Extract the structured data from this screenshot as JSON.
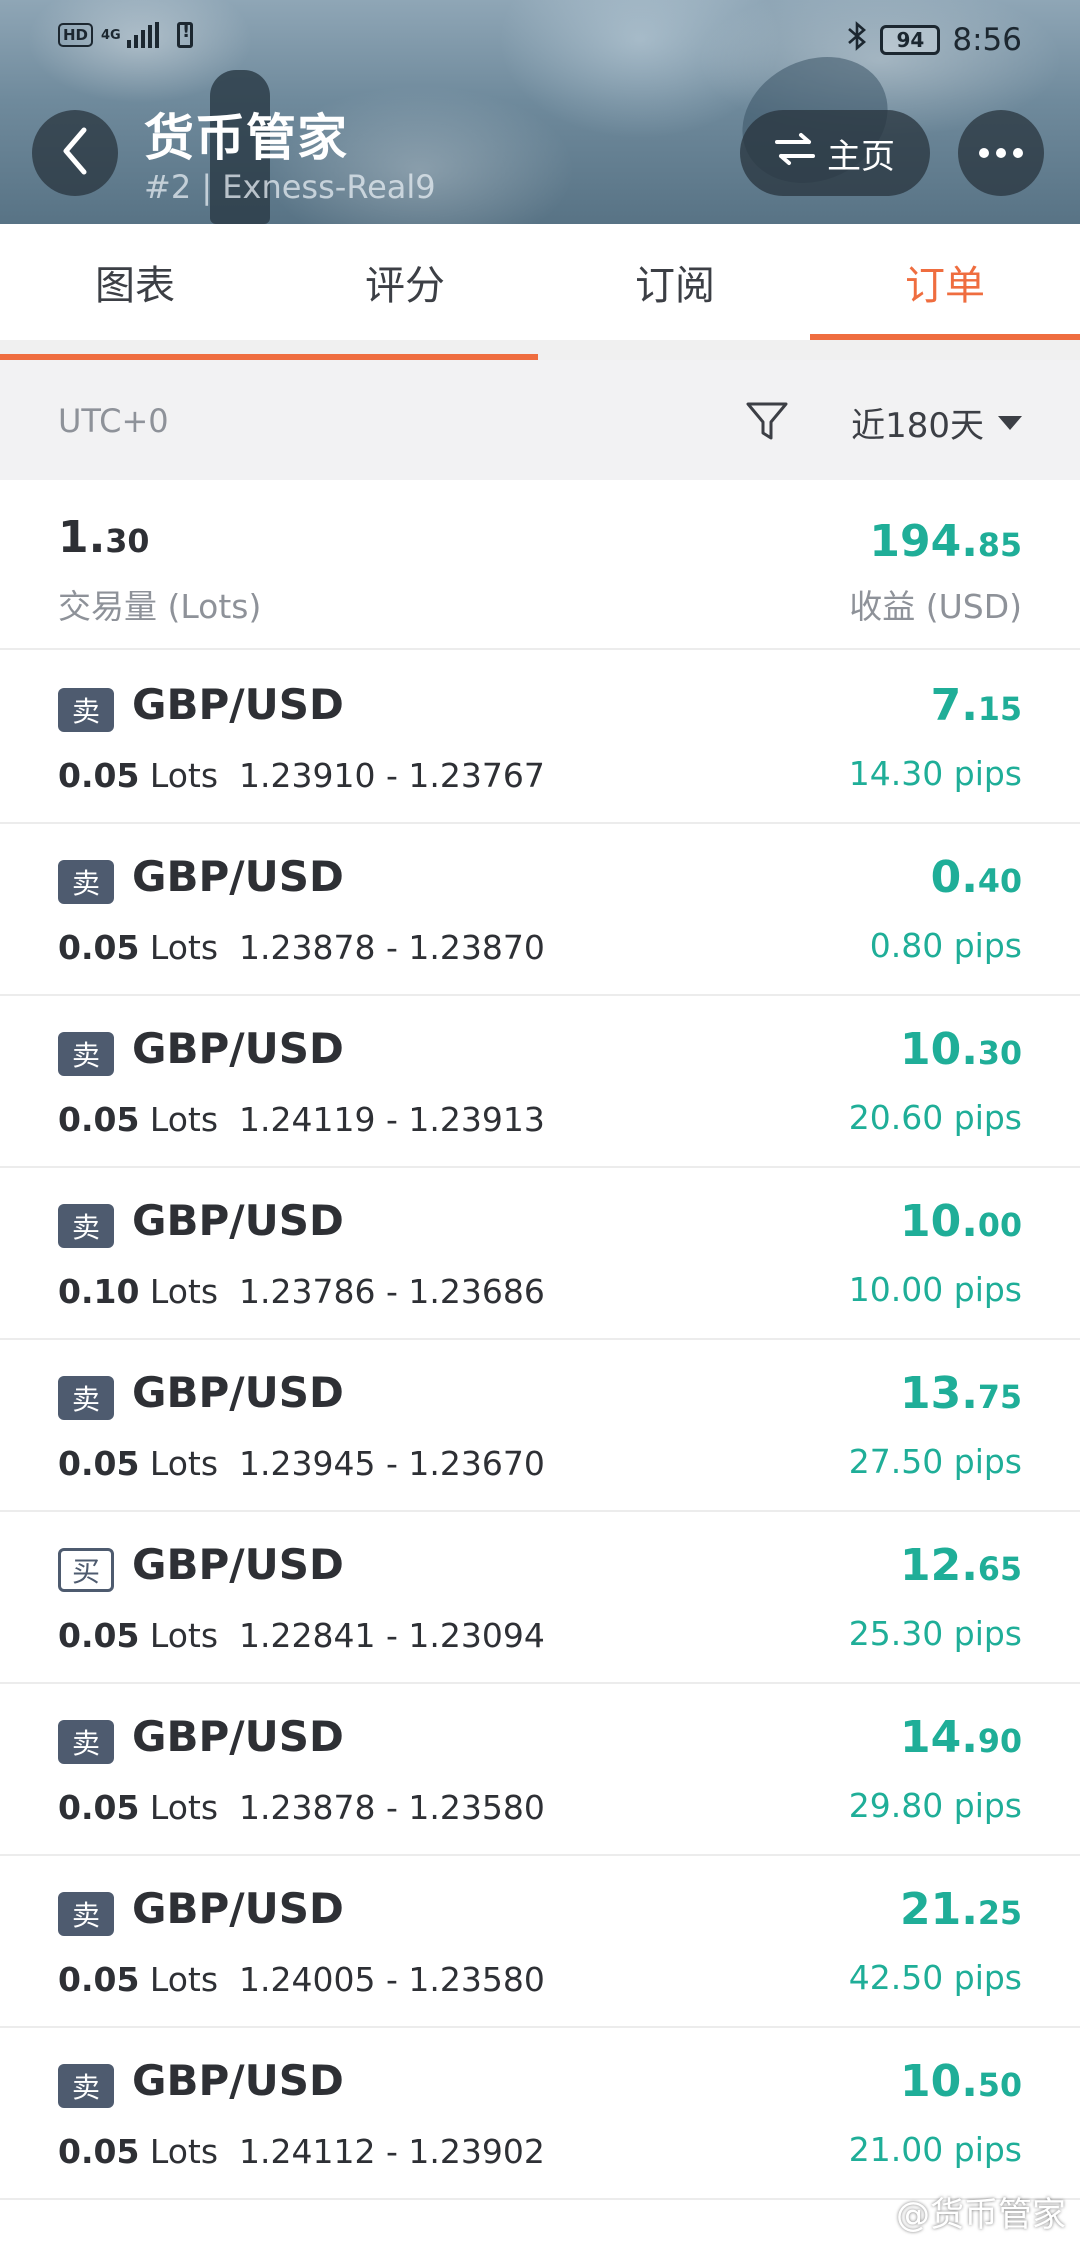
{
  "status_bar": {
    "network_badge": "HD",
    "network_type": "4G",
    "battery_level": "94",
    "time": "8:56"
  },
  "header": {
    "title": "货币管家",
    "subtitle": "#2 | Exness-Real9",
    "home_label": "主页"
  },
  "tabs": [
    {
      "label": "图表",
      "active": false
    },
    {
      "label": "评分",
      "active": false
    },
    {
      "label": "订阅",
      "active": false
    },
    {
      "label": "订单",
      "active": true
    }
  ],
  "filter": {
    "timezone": "UTC+0",
    "period": "近180天"
  },
  "summary": {
    "volume_int": "1.",
    "volume_dec": "30",
    "volume_label": "交易量 (Lots)",
    "profit_int": "194.",
    "profit_dec": "85",
    "profit_label": "收益 (USD)"
  },
  "orders": [
    {
      "side": "卖",
      "type": "sell",
      "symbol": "GBP/USD",
      "lots": "0.05",
      "lots_unit": "Lots",
      "prices": "1.23910 - 1.23767",
      "profit_int": "7.",
      "profit_dec": "15",
      "pips": "14.30 pips"
    },
    {
      "side": "卖",
      "type": "sell",
      "symbol": "GBP/USD",
      "lots": "0.05",
      "lots_unit": "Lots",
      "prices": "1.23878 - 1.23870",
      "profit_int": "0.",
      "profit_dec": "40",
      "pips": "0.80 pips"
    },
    {
      "side": "卖",
      "type": "sell",
      "symbol": "GBP/USD",
      "lots": "0.05",
      "lots_unit": "Lots",
      "prices": "1.24119 - 1.23913",
      "profit_int": "10.",
      "profit_dec": "30",
      "pips": "20.60 pips"
    },
    {
      "side": "卖",
      "type": "sell",
      "symbol": "GBP/USD",
      "lots": "0.10",
      "lots_unit": "Lots",
      "prices": "1.23786 - 1.23686",
      "profit_int": "10.",
      "profit_dec": "00",
      "pips": "10.00 pips"
    },
    {
      "side": "卖",
      "type": "sell",
      "symbol": "GBP/USD",
      "lots": "0.05",
      "lots_unit": "Lots",
      "prices": "1.23945 - 1.23670",
      "profit_int": "13.",
      "profit_dec": "75",
      "pips": "27.50 pips"
    },
    {
      "side": "买",
      "type": "buy",
      "symbol": "GBP/USD",
      "lots": "0.05",
      "lots_unit": "Lots",
      "prices": "1.22841 - 1.23094",
      "profit_int": "12.",
      "profit_dec": "65",
      "pips": "25.30 pips"
    },
    {
      "side": "卖",
      "type": "sell",
      "symbol": "GBP/USD",
      "lots": "0.05",
      "lots_unit": "Lots",
      "prices": "1.23878 - 1.23580",
      "profit_int": "14.",
      "profit_dec": "90",
      "pips": "29.80 pips"
    },
    {
      "side": "卖",
      "type": "sell",
      "symbol": "GBP/USD",
      "lots": "0.05",
      "lots_unit": "Lots",
      "prices": "1.24005 - 1.23580",
      "profit_int": "21.",
      "profit_dec": "25",
      "pips": "42.50 pips"
    },
    {
      "side": "卖",
      "type": "sell",
      "symbol": "GBP/USD",
      "lots": "0.05",
      "lots_unit": "Lots",
      "prices": "1.24112 - 1.23902",
      "profit_int": "10.",
      "profit_dec": "50",
      "pips": "21.00 pips"
    }
  ],
  "watermark": "@货币管家",
  "colors": {
    "accent": "#ef6d3f",
    "profit": "#1fae98",
    "sell_badge": "#4e5b6f"
  },
  "icons": [
    "back-arrow-icon",
    "swap-icon",
    "more-icon",
    "filter-icon",
    "caret-down-icon",
    "bluetooth-icon",
    "battery-icon",
    "signal-icon"
  ]
}
